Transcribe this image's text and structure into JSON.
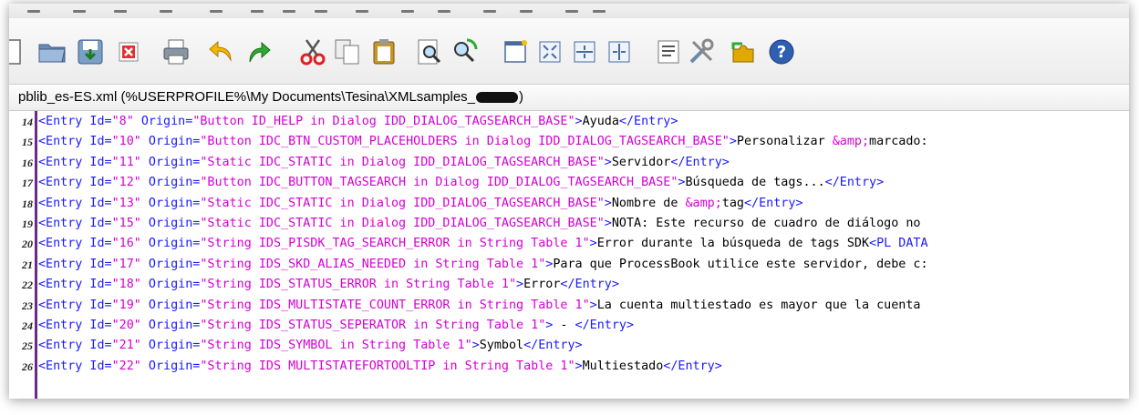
{
  "toolbar": {
    "icons": [
      "new-file-icon",
      "open-folder-icon",
      "save-icon",
      "close-icon",
      "print-icon",
      "undo-icon",
      "redo-icon",
      "cut-icon",
      "copy-icon",
      "paste-icon",
      "find-icon",
      "find-replace-icon",
      "new-window-icon",
      "expand-icon",
      "split-horizontal-icon",
      "split-vertical-icon",
      "properties-icon",
      "tools-icon",
      "plugin-icon",
      "help-icon"
    ]
  },
  "path_bar": {
    "text_before": "pblib_es-ES.xml (%USERPROFILE%\\My Documents\\Tesina\\XMLsamples_",
    "text_after": ")"
  },
  "colors": {
    "tag": "#1a1aff",
    "value": "#d400d4",
    "text": "#000000",
    "gutter_bar": "#6b2a85"
  },
  "lines": [
    {
      "num": "14",
      "id": "\"8\"",
      "origin": "\"Button ID_HELP in Dialog IDD_DIALOG_TAGSEARCH_BASE\"",
      "text": "Ayuda",
      "close": "</Entry>"
    },
    {
      "num": "15",
      "id": "\"10\"",
      "origin": "\"Button IDC_BTN_CUSTOM_PLACEHOLDERS in Dialog IDD_DIALOG_TAGSEARCH_BASE\"",
      "text": "Personalizar ",
      "entity": "&amp;",
      "text2": "marcado:",
      "close": ""
    },
    {
      "num": "16",
      "id": "\"11\"",
      "origin": "\"Static IDC_STATIC in Dialog IDD_DIALOG_TAGSEARCH_BASE\"",
      "text": "Servidor",
      "close": "</Entry>"
    },
    {
      "num": "17",
      "id": "\"12\"",
      "origin": "\"Button IDC_BUTTON_TAGSEARCH in Dialog IDD_DIALOG_TAGSEARCH_BASE\"",
      "text": "Búsqueda de tags...",
      "close": "</Entry>"
    },
    {
      "num": "18",
      "id": "\"13\"",
      "origin": "\"Static IDC_STATIC in Dialog IDD_DIALOG_TAGSEARCH_BASE\"",
      "text": "Nombre de ",
      "entity": "&amp;",
      "text2": "tag",
      "close": "</Entry>"
    },
    {
      "num": "19",
      "id": "\"15\"",
      "origin": "\"Static IDC_STATIC in Dialog IDD_DIALOG_TAGSEARCH_BASE\"",
      "text": "NOTA: Este recurso de cuadro de diálogo no",
      "close": ""
    },
    {
      "num": "20",
      "id": "\"16\"",
      "origin": "\"String IDS_PISDK_TAG_SEARCH_ERROR in String Table 1\"",
      "text": "Error durante la búsqueda de tags SDK",
      "close": "<PL DATA"
    },
    {
      "num": "21",
      "id": "\"17\"",
      "origin": "\"String IDS_SKD_ALIAS_NEEDED in String Table 1\"",
      "text": "Para que ProcessBook utilice este servidor, debe c:",
      "close": ""
    },
    {
      "num": "22",
      "id": "\"18\"",
      "origin": "\"String IDS_STATUS_ERROR in String Table 1\"",
      "text": "Error",
      "close": "</Entry>"
    },
    {
      "num": "23",
      "id": "\"19\"",
      "origin": "\"String IDS_MULTISTATE_COUNT_ERROR in String Table 1\"",
      "text": "La cuenta multiestado es mayor que la cuenta",
      "close": ""
    },
    {
      "num": "24",
      "id": "\"20\"",
      "origin": "\"String IDS_STATUS_SEPERATOR in String Table 1\"",
      "text": " - ",
      "close": "</Entry>"
    },
    {
      "num": "25",
      "id": "\"21\"",
      "origin": "\"String IDS_SYMBOL in String Table 1\"",
      "text": "Symbol",
      "close": "</Entry>"
    },
    {
      "num": "26",
      "id": "\"22\"",
      "origin": "\"String IDS MULTISTATEFORTOOLTIP in String Table 1\"",
      "text": "Multiestado",
      "close": "</Entry>"
    }
  ],
  "syntax": {
    "open_tag": "<Entry",
    "id_attr": " Id=",
    "origin_attr": " Origin=",
    "gt": ">"
  }
}
